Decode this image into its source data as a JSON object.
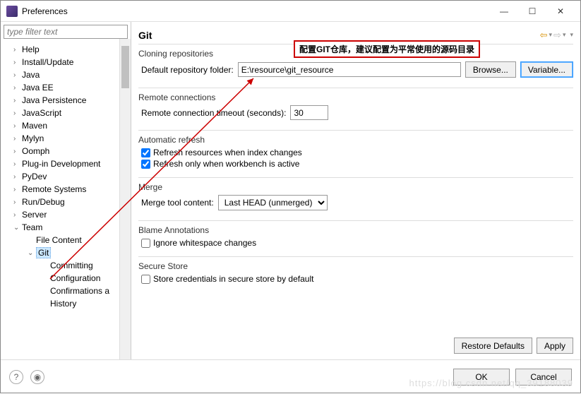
{
  "window": {
    "title": "Preferences"
  },
  "filter": {
    "placeholder": "type filter text"
  },
  "tree": {
    "items": [
      {
        "label": "Help",
        "indent": 1,
        "arrow": ">"
      },
      {
        "label": "Install/Update",
        "indent": 1,
        "arrow": ">"
      },
      {
        "label": "Java",
        "indent": 1,
        "arrow": ">"
      },
      {
        "label": "Java EE",
        "indent": 1,
        "arrow": ">"
      },
      {
        "label": "Java Persistence",
        "indent": 1,
        "arrow": ">"
      },
      {
        "label": "JavaScript",
        "indent": 1,
        "arrow": ">"
      },
      {
        "label": "Maven",
        "indent": 1,
        "arrow": ">"
      },
      {
        "label": "Mylyn",
        "indent": 1,
        "arrow": ">"
      },
      {
        "label": "Oomph",
        "indent": 1,
        "arrow": ">"
      },
      {
        "label": "Plug-in Development",
        "indent": 1,
        "arrow": ">"
      },
      {
        "label": "PyDev",
        "indent": 1,
        "arrow": ">"
      },
      {
        "label": "Remote Systems",
        "indent": 1,
        "arrow": ">"
      },
      {
        "label": "Run/Debug",
        "indent": 1,
        "arrow": ">"
      },
      {
        "label": "Server",
        "indent": 1,
        "arrow": ">"
      },
      {
        "label": "Team",
        "indent": 1,
        "arrow": "v"
      },
      {
        "label": "File Content",
        "indent": 2,
        "arrow": ""
      },
      {
        "label": "Git",
        "indent": 2,
        "arrow": "v",
        "selected": true
      },
      {
        "label": "Committing",
        "indent": 3,
        "arrow": ""
      },
      {
        "label": "Configuration",
        "indent": 3,
        "arrow": ""
      },
      {
        "label": "Confirmations a",
        "indent": 3,
        "arrow": ""
      },
      {
        "label": "History",
        "indent": 3,
        "arrow": ""
      }
    ]
  },
  "page": {
    "title": "Git",
    "cloning": {
      "group": "Cloning repositories",
      "label": "Default repository folder:",
      "value": "E:\\resource\\git_resource",
      "browse": "Browse...",
      "variable": "Variable..."
    },
    "remote": {
      "group": "Remote connections",
      "label": "Remote connection timeout (seconds):",
      "value": "30"
    },
    "auto": {
      "group": "Automatic refresh",
      "opt1": "Refresh resources when index changes",
      "opt2": "Refresh only when workbench is active"
    },
    "merge": {
      "group": "Merge",
      "label": "Merge tool content:",
      "value": "Last HEAD (unmerged)"
    },
    "blame": {
      "group": "Blame Annotations",
      "opt1": "Ignore whitespace changes"
    },
    "secure": {
      "group": "Secure Store",
      "opt1": "Store credentials in secure store by default"
    },
    "restore": "Restore Defaults",
    "apply": "Apply"
  },
  "footer": {
    "ok": "OK",
    "cancel": "Cancel"
  },
  "callout": "配置GIT仓库，建议配置为平常使用的源码目录",
  "watermark": "https://blog.csdn.net/qq_39188039"
}
